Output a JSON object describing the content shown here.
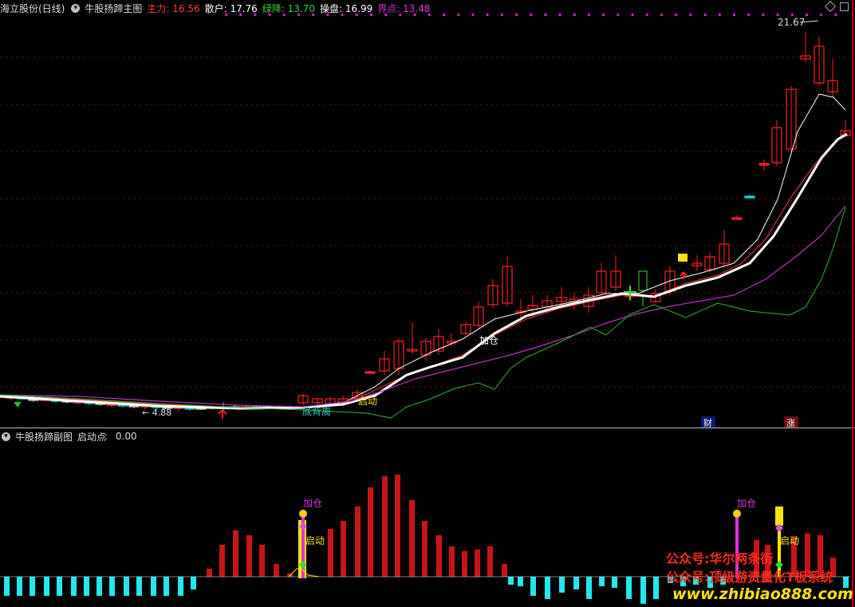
{
  "main_header": {
    "stock": "海立股份(日线)",
    "indicator": "牛股扬蹄主图",
    "items": [
      {
        "label": "主力",
        "value": "16.56",
        "color": "#ff3b3b"
      },
      {
        "label": "散户",
        "value": "17.76",
        "color": "#ffffff"
      },
      {
        "label": "绿降",
        "value": "13.70",
        "color": "#3cd33c"
      },
      {
        "label": "操盘",
        "value": "16.99",
        "color": "#ffffff"
      },
      {
        "label": "界点",
        "value": "13.48",
        "color": "#e030e0"
      }
    ]
  },
  "main_chart": {
    "high_label": "21.67",
    "low_label": "4.88",
    "annotations": {
      "start": "启动",
      "bottom": "底背离",
      "add": "加仓",
      "cai": "财",
      "zhang": "涨"
    }
  },
  "sub_header": {
    "indicator": "牛股扬蹄副图",
    "label": "启动点",
    "value": "0.00"
  },
  "sub_chart": {
    "add_left": "加仓",
    "add_right": "加仓",
    "start_left": "启动",
    "start_right": "启动"
  },
  "watermark": {
    "line1": "公众号:华尔两条街",
    "line2": "公众号:顶级游资量化T板系统",
    "site": "www.zhibiao888.com"
  },
  "colors": {
    "up": "#ff2020",
    "down": "#00ffff",
    "white_line": "#ffffff",
    "magenta": "#e030e0",
    "green": "#3cd33c",
    "cyan_bar": "#22e6f0",
    "red_bar": "#c81414"
  }
}
